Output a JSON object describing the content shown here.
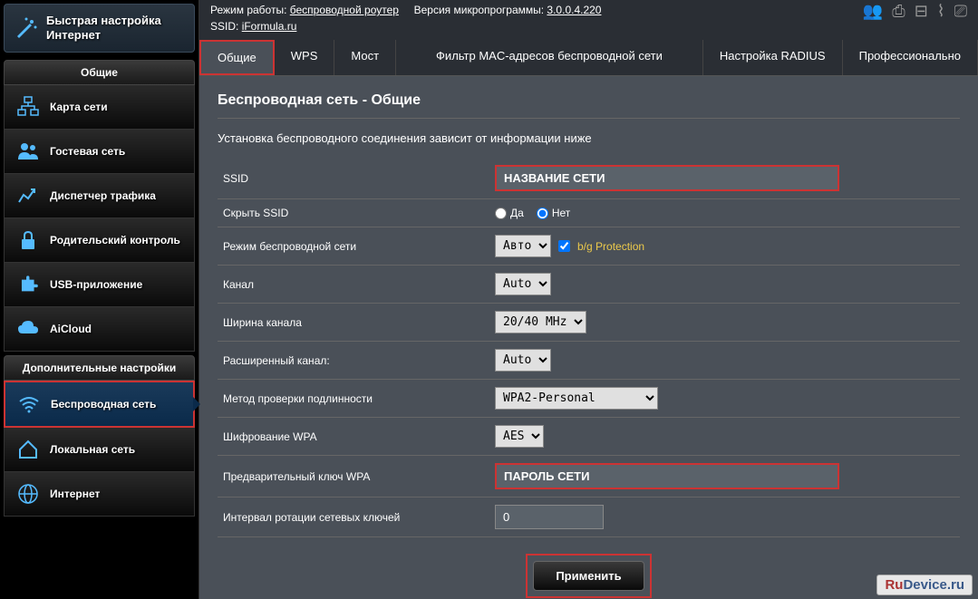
{
  "header": {
    "mode_label": "Режим работы:",
    "mode_value": "беспроводной роутер",
    "fw_label": "Версия микропрограммы:",
    "fw_value": "3.0.0.4.220",
    "ssid_label": "SSID:",
    "ssid_value": "iFormula.ru"
  },
  "quick_setup": "Быстрая настройка Интернет",
  "sections": {
    "general": "Общие",
    "advanced": "Дополнительные настройки"
  },
  "nav": {
    "map": "Карта сети",
    "guest": "Гостевая сеть",
    "traffic": "Диспетчер трафика",
    "parental": "Родительский контроль",
    "usb": "USB-приложение",
    "aicloud": "AiCloud",
    "wireless": "Беспроводная сеть",
    "lan": "Локальная сеть",
    "internet": "Интернет"
  },
  "tabs": {
    "general": "Общие",
    "wps": "WPS",
    "bridge": "Мост",
    "macfilter": "Фильтр MAC-адресов беспроводной сети",
    "radius": "Настройка RADIUS",
    "pro": "Профессионально"
  },
  "page": {
    "title": "Беспроводная сеть - Общие",
    "desc": "Установка беспроводного соединения зависит от информации ниже"
  },
  "form": {
    "ssid_label": "SSID",
    "ssid_value": "НАЗВАНИЕ СЕТИ",
    "hide_label": "Скрыть SSID",
    "yes": "Да",
    "no": "Нет",
    "mode_label": "Режим беспроводной сети",
    "mode_value": "Авто",
    "bg_protection": "b/g Protection",
    "channel_label": "Канал",
    "channel_value": "Auto",
    "width_label": "Ширина канала",
    "width_value": "20/40 MHz",
    "ext_channel_label": "Расширенный канал:",
    "ext_channel_value": "Auto",
    "auth_label": "Метод проверки подлинности",
    "auth_value": "WPA2-Personal",
    "enc_label": "Шифрование WPA",
    "enc_value": "AES",
    "psk_label": "Предварительный ключ WPA",
    "psk_value": "ПАРОЛЬ СЕТИ",
    "rekey_label": "Интервал ротации сетевых ключей",
    "rekey_value": "0",
    "apply": "Применить"
  },
  "watermark": {
    "a": "Ru",
    "b": "Device",
    "c": ".ru"
  }
}
